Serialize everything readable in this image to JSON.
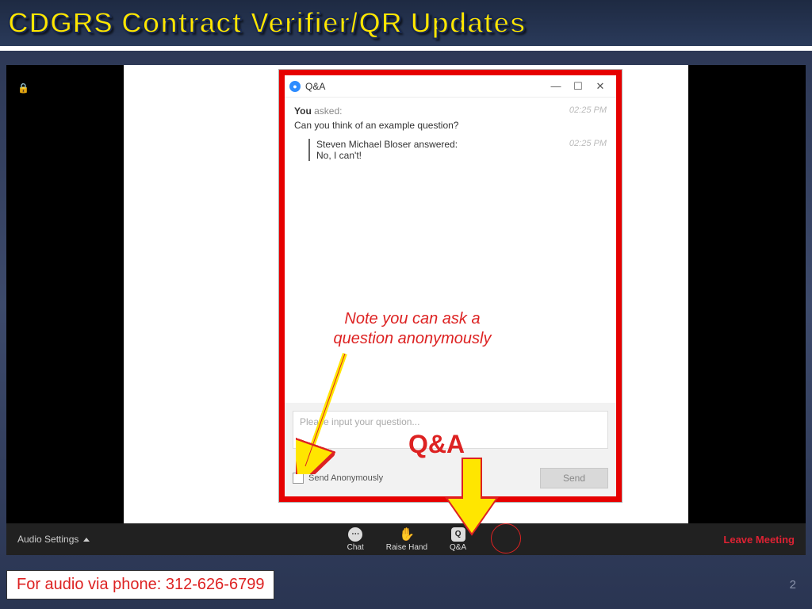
{
  "slide": {
    "title": "CDGRS Contract Verifier/QR Updates",
    "page_number": "2",
    "audio_phone": "For audio via phone: 312-626-6799"
  },
  "zoom_toolbar": {
    "audio_settings": "Audio Settings",
    "chat": "Chat",
    "raise_hand": "Raise Hand",
    "qa": "Q&A",
    "leave": "Leave Meeting"
  },
  "qa_window": {
    "title": "Q&A",
    "asker": "You",
    "asked_verb": "asked:",
    "asked_time": "02:25 PM",
    "question_text": "Can you think of an example question?",
    "answerer": "Steven Michael Bloser",
    "answered_verb": "answered:",
    "answered_time": "02:25 PM",
    "answer_text": "No, I can't!",
    "placeholder": "Please input your question...",
    "anon_label": "Send Anonymously",
    "send": "Send"
  },
  "annotations": {
    "note": "Note you can ask a question anonymously",
    "qa_label": "Q&A"
  }
}
